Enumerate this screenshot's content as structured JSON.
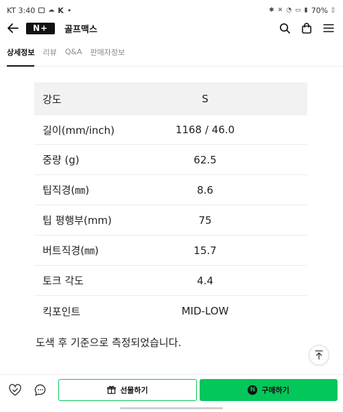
{
  "status_bar": {
    "carrier_time": "KT 3:40",
    "app_badge": "K",
    "dot": "•",
    "battery": "70%"
  },
  "header": {
    "logo": "N+",
    "store_name": "골프맥스"
  },
  "tabs": [
    {
      "label": "상세정보",
      "active": true
    },
    {
      "label": "리뷰",
      "active": false
    },
    {
      "label": "Q&A",
      "active": false
    },
    {
      "label": "판매자정보",
      "active": false
    }
  ],
  "spec_table": [
    {
      "label": "강도",
      "value": "S"
    },
    {
      "label": "길이(mm/inch)",
      "value": "1168 / 46.0"
    },
    {
      "label": "중량 (g)",
      "value": "62.5"
    },
    {
      "label": "팁직경(㎜)",
      "value": "8.6"
    },
    {
      "label": "팁 평행부(mm)",
      "value": "75"
    },
    {
      "label": "버트직경(㎜)",
      "value": "15.7"
    },
    {
      "label": "토크 각도",
      "value": "4.4"
    },
    {
      "label": "킥포인트",
      "value": "MID-LOW"
    }
  ],
  "note": "도색 후 기준으로 측정되었습니다.",
  "bottom_bar": {
    "gift_label": "선물하기",
    "buy_badge": "N",
    "buy_label": "구매하기"
  },
  "colors": {
    "accent": "#03c75a",
    "table_header_bg": "#f2f2f2"
  }
}
